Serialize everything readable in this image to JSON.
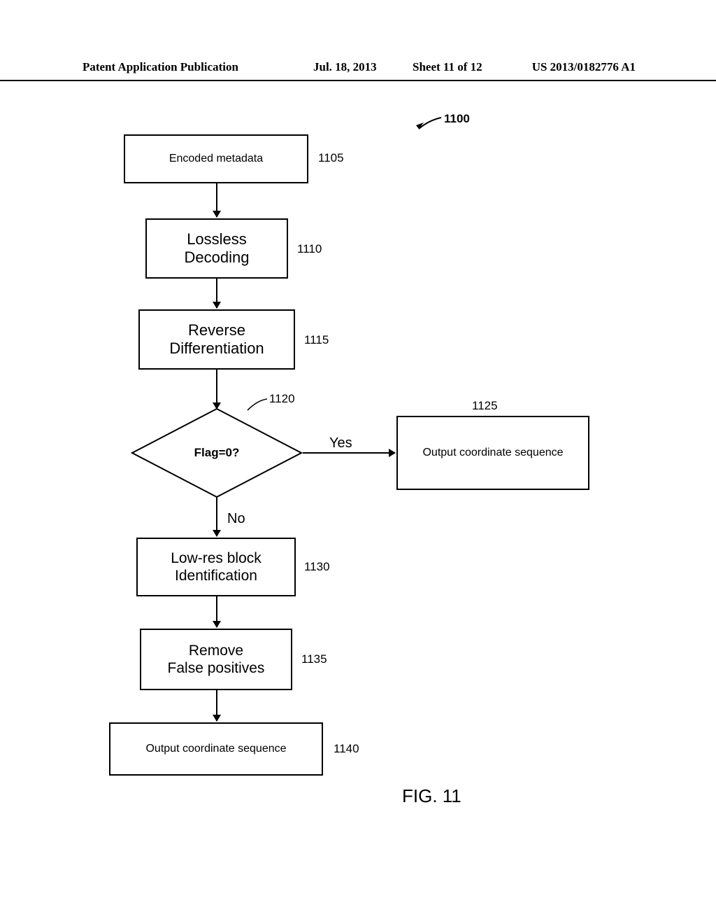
{
  "header": {
    "left": "Patent Application Publication",
    "date": "Jul. 18, 2013",
    "sheet": "Sheet 11 of 12",
    "pubno": "US 2013/0182776 A1"
  },
  "diagram": {
    "overall_ref": "1100",
    "blocks": {
      "b1105": {
        "label": "Encoded metadata",
        "ref": "1105"
      },
      "b1110": {
        "label": "Lossless\nDecoding",
        "ref": "1110"
      },
      "b1115": {
        "label": "Reverse\nDifferentiation",
        "ref": "1115"
      },
      "b1120": {
        "label": "Flag=0?",
        "ref": "1120"
      },
      "b1125": {
        "label": "Output coordinate sequence",
        "ref": "1125"
      },
      "b1130": {
        "label": "Low-res block\nIdentification",
        "ref": "1130"
      },
      "b1135": {
        "label": "Remove\nFalse positives",
        "ref": "1135"
      },
      "b1140": {
        "label": "Output coordinate sequence",
        "ref": "1140"
      }
    },
    "edges": {
      "yes": "Yes",
      "no": "No"
    },
    "figure_label": "FIG. 11"
  }
}
